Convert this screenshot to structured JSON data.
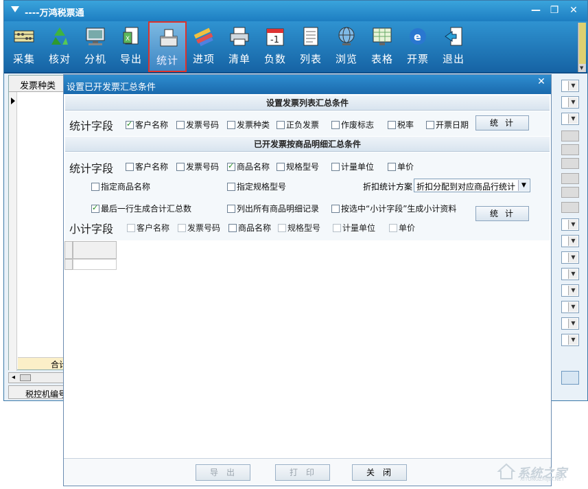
{
  "app": {
    "title": "----万鸿税票通",
    "min": "—",
    "max": "❐",
    "close": "✕"
  },
  "toolbar": {
    "buttons": [
      {
        "label": "采集",
        "icon": "abacus-icon"
      },
      {
        "label": "核对",
        "icon": "recycle-icon"
      },
      {
        "label": "分机",
        "icon": "monitor-icon"
      },
      {
        "label": "导出",
        "icon": "export-icon"
      },
      {
        "label": "统计",
        "icon": "ballot-box-icon",
        "active": true
      },
      {
        "label": "进项",
        "icon": "pencils-icon"
      },
      {
        "label": "清单",
        "icon": "printer-icon"
      },
      {
        "label": "负数",
        "icon": "calendar-minus-icon"
      },
      {
        "label": "列表",
        "icon": "document-list-icon"
      },
      {
        "label": "浏览",
        "icon": "globe-browse-icon"
      },
      {
        "label": "表格",
        "icon": "spreadsheet-icon"
      },
      {
        "label": "开票",
        "icon": "ie-icon"
      },
      {
        "label": "退出",
        "icon": "exit-icon"
      }
    ]
  },
  "background": {
    "grid_header": "发票种类",
    "total_label": "合计",
    "status_label": "税控机编号"
  },
  "dialog": {
    "title": "设置已开发票汇总条件",
    "close": "✕",
    "section1": {
      "heading": "设置发票列表汇总条件",
      "field_label": "统计字段",
      "checks": [
        {
          "label": "客户名称",
          "checked": true
        },
        {
          "label": "发票号码",
          "checked": false
        },
        {
          "label": "发票种类",
          "checked": false
        },
        {
          "label": "正负发票",
          "checked": false
        },
        {
          "label": "作废标志",
          "checked": false
        },
        {
          "label": "税率",
          "checked": false
        },
        {
          "label": "开票日期",
          "checked": false
        }
      ],
      "button": "统计"
    },
    "section2": {
      "heading": "已开发票按商品明细汇总条件",
      "field_label": "统计字段",
      "checks": [
        {
          "label": "客户名称",
          "checked": false
        },
        {
          "label": "发票号码",
          "checked": false
        },
        {
          "label": "商品名称",
          "checked": true
        },
        {
          "label": "规格型号",
          "checked": false
        },
        {
          "label": "计量单位",
          "checked": false
        },
        {
          "label": "单价",
          "checked": false
        }
      ],
      "opt_specify_name": {
        "label": "指定商品名称",
        "checked": false
      },
      "opt_specify_model": {
        "label": "指定规格型号",
        "checked": false
      },
      "discount_label": "折扣统计方案",
      "discount_value": "折扣分配到对应商品行统计",
      "opt_last_row_total": {
        "label": "最后一行生成合计汇总数",
        "checked": true
      },
      "opt_list_all": {
        "label": "列出所有商品明细记录",
        "checked": false
      },
      "opt_subtotal": {
        "label": "按选中“小计字段”生成小计资料",
        "checked": false
      },
      "subtotal_label": "小计字段",
      "subtotal_checks": [
        {
          "label": "客户名称",
          "checked": false
        },
        {
          "label": "发票号码",
          "checked": false
        },
        {
          "label": "商品名称",
          "checked": false
        },
        {
          "label": "规格型号",
          "checked": false
        },
        {
          "label": "计量单位",
          "checked": false
        },
        {
          "label": "单价",
          "checked": false
        }
      ],
      "button": "统计"
    },
    "footer": {
      "export": "导出",
      "print": "打印",
      "close": "关闭"
    }
  },
  "watermark": {
    "text": "系统之家",
    "sub": "XITONGZHIJIA.NET"
  }
}
